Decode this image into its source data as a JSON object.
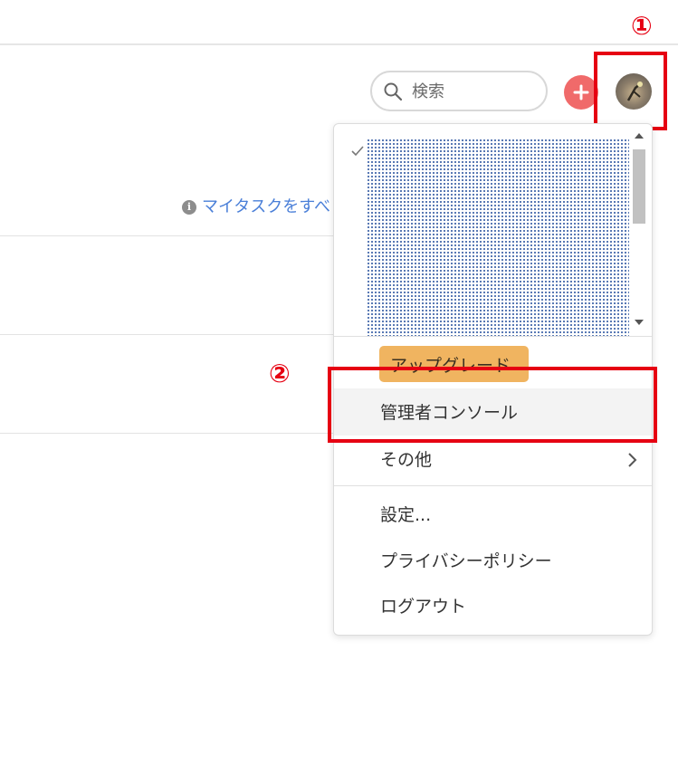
{
  "header": {
    "search": {
      "placeholder": "検索"
    },
    "add_button_icon": "plus-icon",
    "avatar_icon": "user-photo"
  },
  "page": {
    "info_link": "マイタスクをすべ"
  },
  "dropdown": {
    "workspace_list": {
      "selected_icon": "check-icon",
      "content": "pixelated-redacted"
    },
    "upgrade_label": "アップグレード",
    "items": [
      {
        "label": "管理者コンソール"
      },
      {
        "label": "その他"
      },
      {
        "label": "設定..."
      },
      {
        "label": "プライバシーポリシー"
      },
      {
        "label": "ログアウト"
      }
    ]
  },
  "annotations": {
    "marker_1": "①",
    "marker_2": "②",
    "color": "#e60012"
  },
  "colors": {
    "accent_add": "#f06a6a",
    "upgrade": "#f0b460",
    "link": "#4a7fd8"
  }
}
